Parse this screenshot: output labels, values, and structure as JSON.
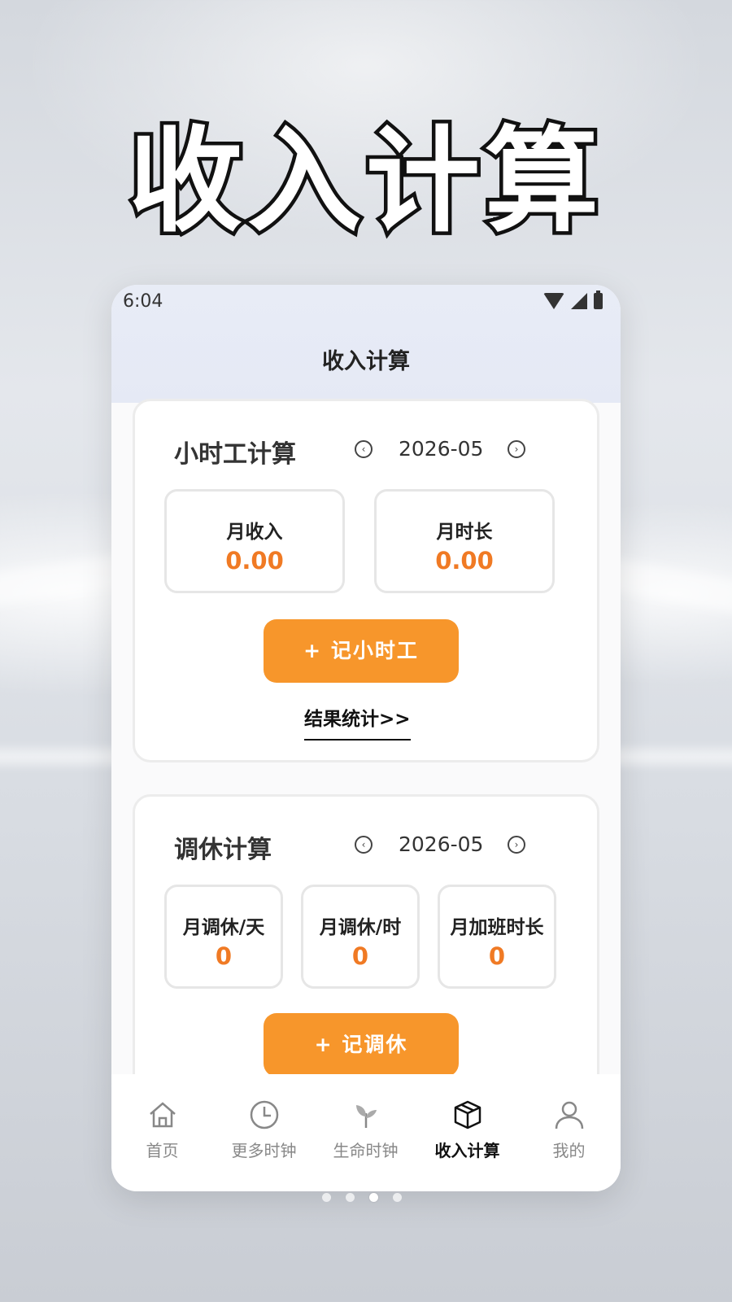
{
  "promo": {
    "title": "收入计算"
  },
  "status_bar": {
    "time": "6:04"
  },
  "header": {
    "title": "收入计算"
  },
  "hourly_card": {
    "title": "小时工计算",
    "month": "2026-05",
    "stats": [
      {
        "label": "月收入",
        "value": "0.00"
      },
      {
        "label": "月时长",
        "value": "0.00"
      }
    ],
    "add_button": "+ 记小时工",
    "stats_link": "结果统计>>"
  },
  "leave_card": {
    "title": "调休计算",
    "month": "2026-05",
    "stats": [
      {
        "label": "月调休/天",
        "value": "0"
      },
      {
        "label": "月调休/时",
        "value": "0"
      },
      {
        "label": "月加班时长",
        "value": "0"
      }
    ],
    "add_button": "+ 记调休"
  },
  "tabbar": {
    "items": [
      {
        "label": "首页",
        "icon": "home-icon"
      },
      {
        "label": "更多时钟",
        "icon": "clock-icon"
      },
      {
        "label": "生命时钟",
        "icon": "sprout-icon"
      },
      {
        "label": "收入计算",
        "icon": "box-icon",
        "active": true
      },
      {
        "label": "我的",
        "icon": "user-icon"
      }
    ]
  },
  "colors": {
    "accent": "#f7962b",
    "value": "#f07a24",
    "header_bg": "#e6eaf6"
  }
}
